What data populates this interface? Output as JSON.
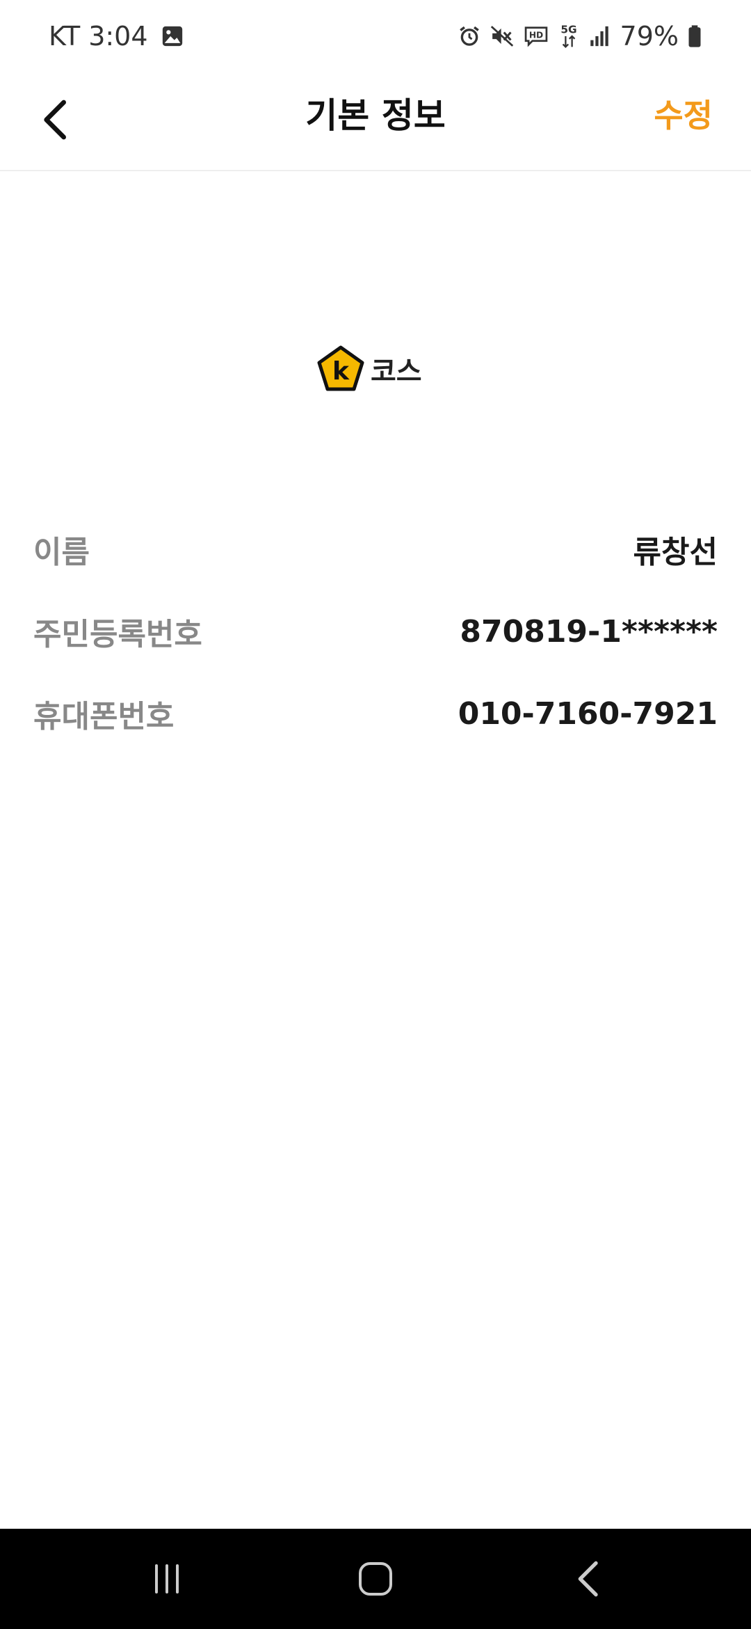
{
  "status_bar": {
    "carrier": "KT",
    "time": "3:04",
    "battery_percent": "79%",
    "icons": [
      "image-icon",
      "alarm-icon",
      "mute-icon",
      "hd-icon",
      "5g-icon",
      "signal-icon",
      "battery-icon"
    ]
  },
  "app_bar": {
    "title": "기본 정보",
    "edit_label": "수정",
    "accent_color": "#F39A1B"
  },
  "logo": {
    "mark": "k",
    "text": "코스",
    "color": "#F5B800"
  },
  "info": {
    "rows": [
      {
        "label": "이름",
        "value": "류창선"
      },
      {
        "label": "주민등록번호",
        "value": "870819-1******"
      },
      {
        "label": "휴대폰번호",
        "value": "010-7160-7921"
      }
    ]
  },
  "nav_bar": {
    "icons": [
      "recents-icon",
      "home-icon",
      "back-icon"
    ]
  }
}
